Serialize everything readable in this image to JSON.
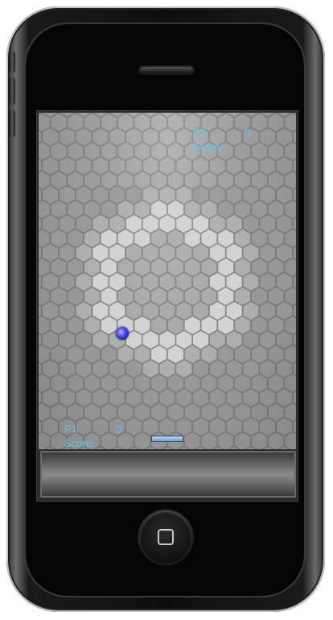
{
  "device": {
    "icons": {
      "home": "home-square-icon",
      "speaker": "speaker-grille"
    }
  },
  "hud": {
    "p2": {
      "label": "P2",
      "score_label": "Score:",
      "score": "0"
    },
    "p1": {
      "label": "P1",
      "score_label": "Score:",
      "score": "0"
    }
  },
  "colors": {
    "hud_text": "#66c4e8",
    "ball": "#3f3ff0",
    "paddle": "#8fb6da",
    "tile_light": "#d6d6d6",
    "tile_mid": "#b5b5b5",
    "tile_dark": "#9a9a9a"
  }
}
